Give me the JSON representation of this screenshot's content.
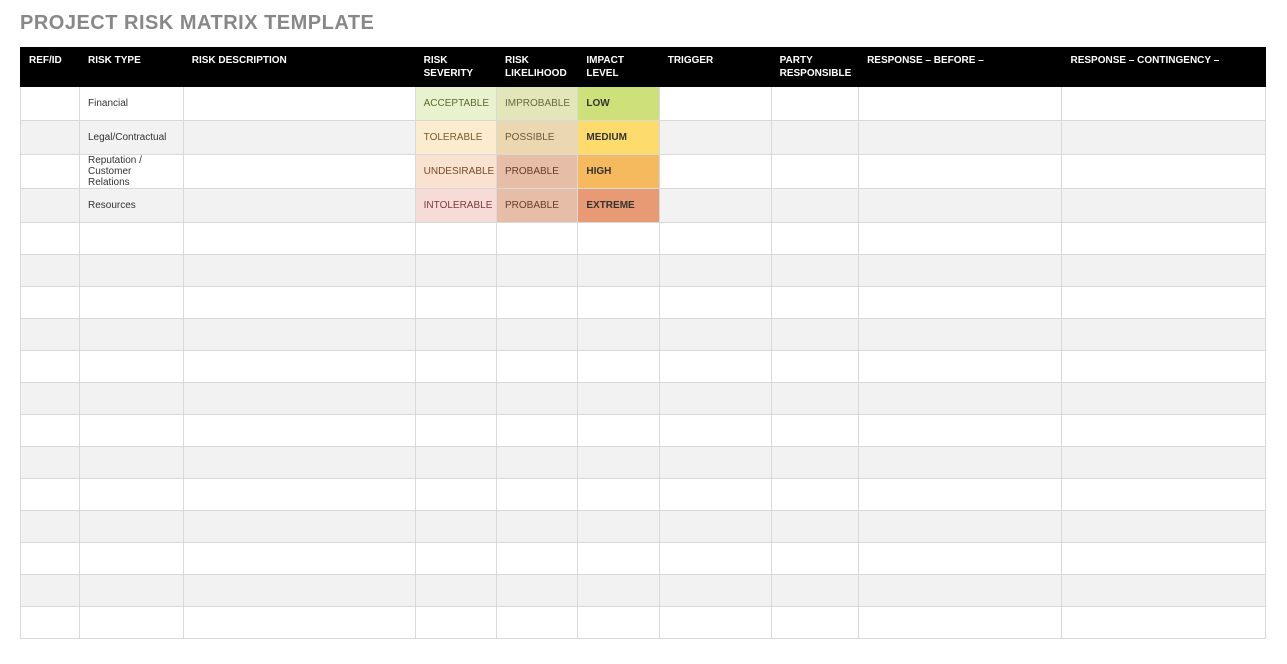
{
  "title": "PROJECT RISK MATRIX TEMPLATE",
  "columns": {
    "refid": "REF/ID",
    "risktype": "RISK TYPE",
    "riskdesc": "RISK DESCRIPTION",
    "severity": "RISK SEVERITY",
    "likelihood": "RISK LIKELIHOOD",
    "impact": "IMPACT LEVEL",
    "trigger": "TRIGGER",
    "party": "PARTY RESPONSIBLE",
    "before": "RESPONSE – BEFORE –",
    "conting": "RESPONSE – CONTINGENCY –"
  },
  "rows": [
    {
      "refid": "",
      "risktype": "Financial",
      "riskdesc": "",
      "severity": "ACCEPTABLE",
      "likelihood": "IMPROBABLE",
      "impact": "LOW",
      "trigger": "",
      "party": "",
      "before": "",
      "conting": ""
    },
    {
      "refid": "",
      "risktype": "Legal/Contractual",
      "riskdesc": "",
      "severity": "TOLERABLE",
      "likelihood": "POSSIBLE",
      "impact": "MEDIUM",
      "trigger": "",
      "party": "",
      "before": "",
      "conting": ""
    },
    {
      "refid": "",
      "risktype": "Reputation / Customer Relations",
      "riskdesc": "",
      "severity": "UNDESIRABLE",
      "likelihood": "PROBABLE",
      "impact": "HIGH",
      "trigger": "",
      "party": "",
      "before": "",
      "conting": ""
    },
    {
      "refid": "",
      "risktype": "Resources",
      "riskdesc": "",
      "severity": "INTOLERABLE",
      "likelihood": "PROBABLE",
      "impact": "EXTREME",
      "trigger": "",
      "party": "",
      "before": "",
      "conting": ""
    },
    {
      "refid": "",
      "risktype": "",
      "riskdesc": "",
      "severity": "",
      "likelihood": "",
      "impact": "",
      "trigger": "",
      "party": "",
      "before": "",
      "conting": ""
    },
    {
      "refid": "",
      "risktype": "",
      "riskdesc": "",
      "severity": "",
      "likelihood": "",
      "impact": "",
      "trigger": "",
      "party": "",
      "before": "",
      "conting": ""
    },
    {
      "refid": "",
      "risktype": "",
      "riskdesc": "",
      "severity": "",
      "likelihood": "",
      "impact": "",
      "trigger": "",
      "party": "",
      "before": "",
      "conting": ""
    },
    {
      "refid": "",
      "risktype": "",
      "riskdesc": "",
      "severity": "",
      "likelihood": "",
      "impact": "",
      "trigger": "",
      "party": "",
      "before": "",
      "conting": ""
    },
    {
      "refid": "",
      "risktype": "",
      "riskdesc": "",
      "severity": "",
      "likelihood": "",
      "impact": "",
      "trigger": "",
      "party": "",
      "before": "",
      "conting": ""
    },
    {
      "refid": "",
      "risktype": "",
      "riskdesc": "",
      "severity": "",
      "likelihood": "",
      "impact": "",
      "trigger": "",
      "party": "",
      "before": "",
      "conting": ""
    },
    {
      "refid": "",
      "risktype": "",
      "riskdesc": "",
      "severity": "",
      "likelihood": "",
      "impact": "",
      "trigger": "",
      "party": "",
      "before": "",
      "conting": ""
    },
    {
      "refid": "",
      "risktype": "",
      "riskdesc": "",
      "severity": "",
      "likelihood": "",
      "impact": "",
      "trigger": "",
      "party": "",
      "before": "",
      "conting": ""
    },
    {
      "refid": "",
      "risktype": "",
      "riskdesc": "",
      "severity": "",
      "likelihood": "",
      "impact": "",
      "trigger": "",
      "party": "",
      "before": "",
      "conting": ""
    },
    {
      "refid": "",
      "risktype": "",
      "riskdesc": "",
      "severity": "",
      "likelihood": "",
      "impact": "",
      "trigger": "",
      "party": "",
      "before": "",
      "conting": ""
    },
    {
      "refid": "",
      "risktype": "",
      "riskdesc": "",
      "severity": "",
      "likelihood": "",
      "impact": "",
      "trigger": "",
      "party": "",
      "before": "",
      "conting": ""
    },
    {
      "refid": "",
      "risktype": "",
      "riskdesc": "",
      "severity": "",
      "likelihood": "",
      "impact": "",
      "trigger": "",
      "party": "",
      "before": "",
      "conting": ""
    },
    {
      "refid": "",
      "risktype": "",
      "riskdesc": "",
      "severity": "",
      "likelihood": "",
      "impact": "",
      "trigger": "",
      "party": "",
      "before": "",
      "conting": ""
    }
  ],
  "severityClass": {
    "ACCEPTABLE": "sev-acceptable",
    "TOLERABLE": "sev-tolerable",
    "UNDESIRABLE": "sev-undesirable",
    "INTOLERABLE": "sev-intolerable"
  },
  "likelihoodClass": {
    "IMPROBABLE": "lik-improbable",
    "POSSIBLE": "lik-possible",
    "PROBABLE": "lik-probable1"
  },
  "impactClass": {
    "LOW": "imp-low",
    "MEDIUM": "imp-medium",
    "HIGH": "imp-high",
    "EXTREME": "imp-extreme"
  }
}
